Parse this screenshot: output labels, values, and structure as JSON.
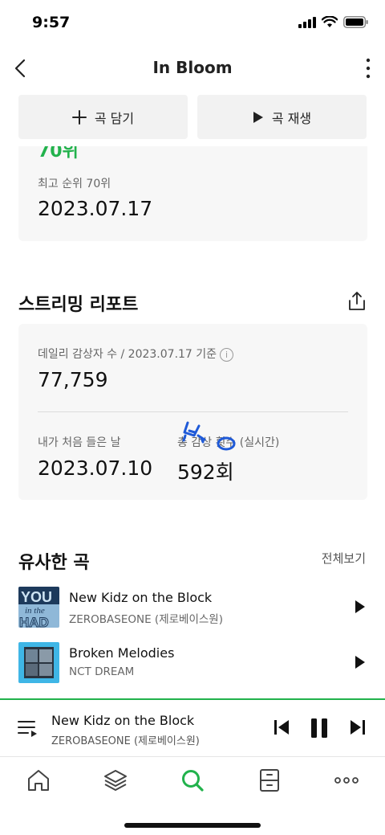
{
  "status_bar": {
    "time": "9:57"
  },
  "nav": {
    "title": "In Bloom"
  },
  "actions": {
    "add_label": "곡 담기",
    "play_label": "곡 재생"
  },
  "chart_rank": {
    "current_rank_partial": "70위",
    "peak_label": "최고 순위 70위",
    "peak_date": "2023.07.17"
  },
  "streaming": {
    "section_title": "스트리밍 리포트",
    "daily_label": "데일리 감상자 수 / 2023.07.17 기준",
    "daily_value": "77,759",
    "first_listen_label": "내가 처음 들은 날",
    "first_listen_value": "2023.07.10",
    "total_label": "총 감상 횟수 (실시간)",
    "total_value": "592회"
  },
  "similar": {
    "section_title": "유사한 곡",
    "see_all": "전체보기",
    "songs": [
      {
        "title": "New Kidz on the Block",
        "artist": "ZEROBASEONE (제로베이스원)"
      },
      {
        "title": "Broken Melodies",
        "artist": "NCT DREAM"
      }
    ]
  },
  "mini_player": {
    "title": "New Kidz on the Block",
    "artist": "ZEROBASEONE (제로베이스원)"
  },
  "colors": {
    "accent": "#22b24c",
    "annotation": "#1f5ad8"
  },
  "icons": {
    "nav": [
      "back-icon",
      "more-icon"
    ],
    "tabs": [
      "home-icon",
      "layers-icon",
      "search-icon",
      "storage-icon",
      "more-dots-icon"
    ]
  }
}
